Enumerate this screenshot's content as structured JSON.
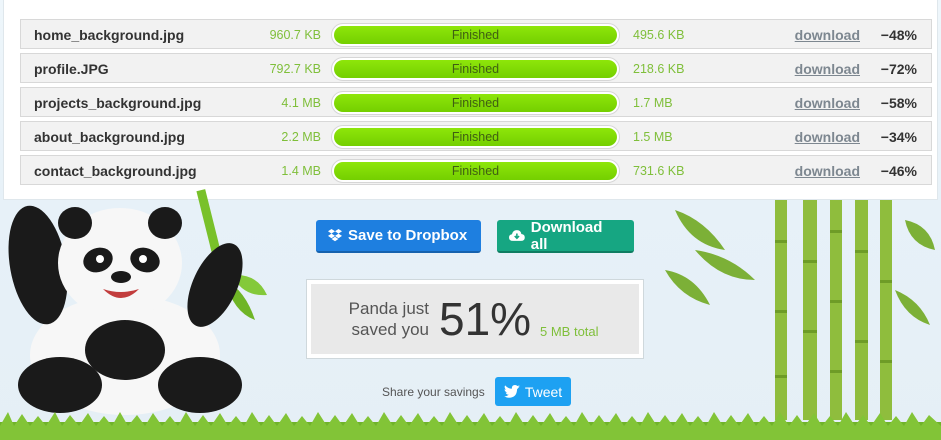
{
  "files": [
    {
      "name": "home_background.jpg",
      "original_size": "960.7 KB",
      "status": "Finished",
      "progress": 1.0,
      "new_size": "495.6 KB",
      "download_label": "download",
      "saving": "−48%"
    },
    {
      "name": "profile.JPG",
      "original_size": "792.7 KB",
      "status": "Finished",
      "progress": 1.0,
      "new_size": "218.6 KB",
      "download_label": "download",
      "saving": "−72%"
    },
    {
      "name": "projects_background.jpg",
      "original_size": "4.1 MB",
      "status": "Finished",
      "progress": 1.0,
      "new_size": "1.7 MB",
      "download_label": "download",
      "saving": "−58%"
    },
    {
      "name": "about_background.jpg",
      "original_size": "2.2 MB",
      "status": "Finished",
      "progress": 1.0,
      "new_size": "1.5 MB",
      "download_label": "download",
      "saving": "−34%"
    },
    {
      "name": "contact_background.jpg",
      "original_size": "1.4 MB",
      "status": "Finished",
      "progress": 1.0,
      "new_size": "731.6 KB",
      "download_label": "download",
      "saving": "−46%"
    }
  ],
  "actions": {
    "dropbox_label": "Save to Dropbox",
    "dropbox_icon": "dropbox-icon",
    "download_all_label": "Download all",
    "download_all_icon": "cloud-download-icon"
  },
  "savings": {
    "label": "Panda just saved you",
    "percent": "51%",
    "total": "5 MB total"
  },
  "share": {
    "label": "Share your savings",
    "tweet_label": "Tweet",
    "tweet_icon": "twitter-bird-icon"
  },
  "colors": {
    "progress_green": "#7ed60a",
    "size_green": "#7fbf3a",
    "dropbox_blue": "#1e7fe0",
    "download_teal": "#16a682",
    "twitter_blue": "#1da1f2"
  }
}
